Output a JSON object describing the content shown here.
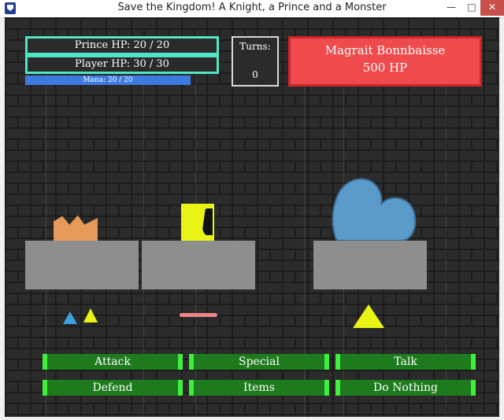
{
  "window": {
    "title": "Save the Kingdom! A Knight, a Prince and a Monster",
    "minimize_glyph": "—",
    "maximize_glyph": "□",
    "close_glyph": "✕"
  },
  "hud": {
    "prince_hp": "Prince HP: 20 / 20",
    "player_hp": "Player HP: 30 / 30",
    "mana": "Mana: 20 / 20",
    "turns_label": "Turns:",
    "turns_value": "0",
    "boss_name": "Magrait Bonnbaisse",
    "boss_hp": "500 HP"
  },
  "commands": {
    "attack": "Attack",
    "special": "Special",
    "talk": "Talk",
    "defend": "Defend",
    "items": "Items",
    "do_nothing": "Do Nothing"
  },
  "colors": {
    "hud_border": "#4ee6c4",
    "mana": "#3d7be0",
    "boss_panel": "#ef4a4c",
    "button_fill": "#1d7a1d",
    "button_edge": "#3cf03c",
    "prince_crown": "#e69a5a",
    "knight_block": "#e9f414",
    "monster": "#5b9bc9",
    "pedestal": "#8e8e8e"
  },
  "icons": {
    "app": "shield-icon",
    "prince": "crown-icon",
    "knight": "yellow-block-icon",
    "monster": "blue-blob-icon"
  }
}
